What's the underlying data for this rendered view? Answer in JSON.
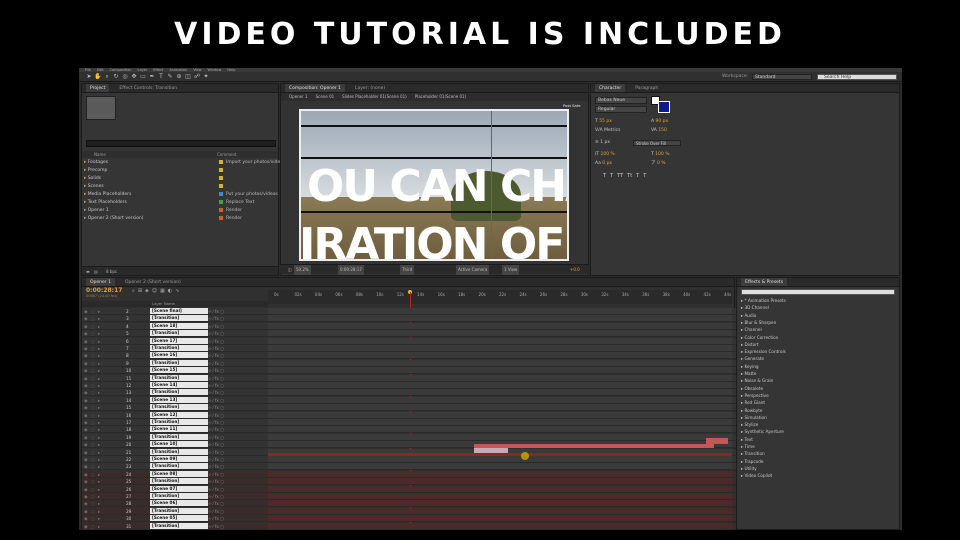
{
  "banner": {
    "title": "VIDEO TUTORIAL IS INCLUDED"
  },
  "menu": [
    "File",
    "Edit",
    "Composition",
    "Layer",
    "Effect",
    "Animation",
    "View",
    "Window",
    "Help"
  ],
  "workspace": {
    "label": "Workspace:",
    "value": "Standard",
    "search_placeholder": "Search Help"
  },
  "project": {
    "tabs": [
      "Project",
      "Effect Controls: Transition"
    ],
    "search_placeholder": "",
    "headers": {
      "name": "Name",
      "comment": "Comment"
    },
    "items": [
      {
        "name": "Footages",
        "comment": "Import your photos/videos here",
        "color": "#d8b030"
      },
      {
        "name": "Precomp",
        "comment": "",
        "color": "#d8b030"
      },
      {
        "name": "Solids",
        "comment": "",
        "color": "#d8b030"
      },
      {
        "name": "Scenes",
        "comment": "",
        "color": "#d8b030"
      },
      {
        "name": "Media Placeholders",
        "comment": "Put your photos/videos",
        "color": "#3a8adf"
      },
      {
        "name": "Text Placeholders",
        "comment": "Replace Text",
        "color": "#3fa04a"
      },
      {
        "name": "Opener 1",
        "comment": "Render",
        "color": "#d06020"
      },
      {
        "name": "Opener 2 (Short version)",
        "comment": "Render",
        "color": "#d06020"
      }
    ],
    "bpc": "8 bpc"
  },
  "composition": {
    "tabs": [
      "Composition: Opener 1",
      "Layer: (none)"
    ],
    "breadcrumbs": [
      "Opener 1",
      "Scene 01",
      "Slides Placeholder 01(Scene 01)",
      "Placeholder 01(Scene 01)"
    ],
    "view_label": "Post Safe",
    "preview_text_1": "OU CAN CHAN",
    "preview_text_2": "IRATION OF AN",
    "zoom": "50.2%",
    "timecode": "0:00:28:17",
    "resolution": "Third",
    "camera": "Active Camera",
    "views": "1 View",
    "exposure": "+0.0"
  },
  "character": {
    "tabs": [
      "Character",
      "Paragraph"
    ],
    "font": "Bebas Neue",
    "style": "Regular",
    "size": "55 px",
    "leading": "90 px",
    "kerning": "Metrics",
    "tracking": "150",
    "stroke": "1 px",
    "stroke_mode": "Stroke Over Fill",
    "vscale": "100 %",
    "hscale": "100 %",
    "baseline": "0 px",
    "tsume": "0 %",
    "styles": [
      "T",
      "T",
      "TT",
      "Tt",
      "T",
      "T"
    ]
  },
  "timeline": {
    "tabs": [
      "Opener 1",
      "Opener 2 (Short version)"
    ],
    "timecode": "0:00:28:17",
    "frames": "00667 (24.00 fps)",
    "column_header": "Layer Name",
    "ruler": [
      "0s",
      "02s",
      "04s",
      "06s",
      "08s",
      "10s",
      "12s",
      "14s",
      "16s",
      "18s",
      "20s",
      "22s",
      "24s",
      "26s",
      "28s",
      "30s",
      "32s",
      "34s",
      "36s",
      "38s",
      "40s",
      "42s",
      "44s"
    ],
    "layers": [
      {
        "n": "2",
        "name": "[Scene final]"
      },
      {
        "n": "3",
        "name": "[Transition]"
      },
      {
        "n": "4",
        "name": "[Scene 18]"
      },
      {
        "n": "5",
        "name": "[Transition]"
      },
      {
        "n": "6",
        "name": "[Scene 17]"
      },
      {
        "n": "7",
        "name": "[Transition]"
      },
      {
        "n": "8",
        "name": "[Scene 16]"
      },
      {
        "n": "9",
        "name": "[Transition]"
      },
      {
        "n": "10",
        "name": "[Scene 15]"
      },
      {
        "n": "11",
        "name": "[Transition]"
      },
      {
        "n": "12",
        "name": "[Scene 14]"
      },
      {
        "n": "13",
        "name": "[Transition]"
      },
      {
        "n": "14",
        "name": "[Scene 13]"
      },
      {
        "n": "15",
        "name": "[Transition]"
      },
      {
        "n": "16",
        "name": "[Scene 12]"
      },
      {
        "n": "17",
        "name": "[Transition]"
      },
      {
        "n": "18",
        "name": "[Scene 11]"
      },
      {
        "n": "19",
        "name": "[Transition]"
      },
      {
        "n": "20",
        "name": "[Scene 10]"
      },
      {
        "n": "21",
        "name": "[Transition]"
      },
      {
        "n": "22",
        "name": "[Scene 09]"
      },
      {
        "n": "23",
        "name": "[Transition]"
      },
      {
        "n": "24",
        "name": "[Scene 08]"
      },
      {
        "n": "25",
        "name": "[Transition]"
      },
      {
        "n": "26",
        "name": "[Scene 07]"
      },
      {
        "n": "27",
        "name": "[Transition]"
      },
      {
        "n": "28",
        "name": "[Scene 06]"
      },
      {
        "n": "29",
        "name": "[Transition]"
      },
      {
        "n": "30",
        "name": "[Scene 05]"
      },
      {
        "n": "31",
        "name": "[Transition]"
      }
    ]
  },
  "effects": {
    "tabs": [
      "Effects & Presets"
    ],
    "search_placeholder": "",
    "items": [
      "* Animation Presets",
      "3D Channel",
      "Audio",
      "Blur & Sharpen",
      "Channel",
      "Color Correction",
      "Distort",
      "Expression Controls",
      "Generate",
      "Keying",
      "Matte",
      "Noise & Grain",
      "Obsolete",
      "Perspective",
      "Red Giant",
      "Rowbyte",
      "Simulation",
      "Stylize",
      "Synthetic Aperture",
      "Text",
      "Time",
      "Transition",
      "Trapcode",
      "Utility",
      "Video Copilot"
    ]
  }
}
